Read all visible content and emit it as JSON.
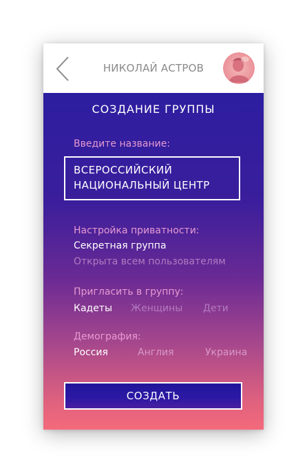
{
  "header": {
    "title": "НИКОЛАЙ АСТРОВ",
    "back_icon": "chevron-left-icon",
    "avatar_icon": "user-avatar"
  },
  "screen": {
    "title": "СОЗДАНИЕ ГРУППЫ"
  },
  "name_section": {
    "label": "Введите название:",
    "value_line1": "ВСЕРОССИЙСКИЙ",
    "value_line2": "НАЦИОНАЛЬНЫЙ ЦЕНТР"
  },
  "privacy_section": {
    "label": "Настройка приватности:",
    "options": [
      "Секретная группа",
      "Открыта всем пользователям"
    ],
    "selected": "Секретная группа"
  },
  "invite_section": {
    "label": "Пригласить в группу:",
    "options": [
      "Кадеты",
      "Женщины",
      "Дети"
    ],
    "selected": "Кадеты"
  },
  "demography_section": {
    "label": "Демография:",
    "options": [
      "Россия",
      "Англия",
      "Украина"
    ],
    "selected": "Россия"
  },
  "actions": {
    "create_label": "СОЗДАТЬ"
  },
  "colors": {
    "gradient_top": "#2c1ea0",
    "gradient_bottom": "#f46a7c",
    "label_pink": "#e79ad2",
    "inactive": "#b37ac0"
  }
}
